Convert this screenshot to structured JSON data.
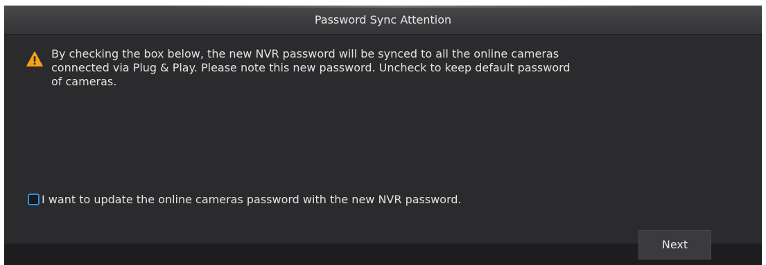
{
  "dialog": {
    "title": "Password Sync Attention",
    "warning_icon": "warning-triangle-icon",
    "message": "By checking the box below, the new NVR password will be synced to all the online cameras\nconnected via Plug & Play. Please note this new password. Uncheck to keep default password\nof cameras.",
    "checkbox": {
      "checked": false,
      "label": "I want to update the online cameras password with the new NVR password."
    },
    "next_label": "Next"
  },
  "colors": {
    "background": "#2b2b2d",
    "title_bar": "#3b3b3e",
    "text": "#e2e2e2",
    "checkbox_border": "#2e8fe6",
    "warning": "#f5a01a"
  }
}
